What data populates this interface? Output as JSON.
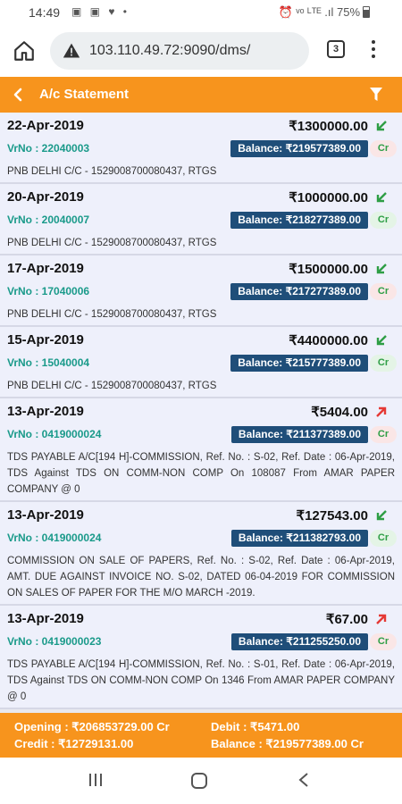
{
  "status": {
    "time": "14:49",
    "icons": "▣ ▣ ♥ •",
    "right": "⏰ ᵛᵒ ᴸᵀᴱ .ıl 75%"
  },
  "browser": {
    "url": "103.110.49.72:9090/dms/",
    "tab_count": "3"
  },
  "header": {
    "title": "A/c Statement"
  },
  "entries": [
    {
      "date": "22-Apr-2019",
      "amount": "₹1300000.00",
      "direction": "in",
      "vrno": "VrNo : 22040003",
      "balance": "Balance: ₹219577389.00",
      "crdr": "Cr",
      "narration": "PNB DELHI C/C - 1529008700080437, RTGS"
    },
    {
      "date": "20-Apr-2019",
      "amount": "₹1000000.00",
      "direction": "in",
      "vrno": "VrNo : 20040007",
      "balance": "Balance: ₹218277389.00",
      "crdr": "Cr",
      "narration": "PNB DELHI C/C - 1529008700080437, RTGS"
    },
    {
      "date": "17-Apr-2019",
      "amount": "₹1500000.00",
      "direction": "in",
      "vrno": "VrNo : 17040006",
      "balance": "Balance: ₹217277389.00",
      "crdr": "Cr",
      "narration": "PNB DELHI C/C - 1529008700080437, RTGS"
    },
    {
      "date": "15-Apr-2019",
      "amount": "₹4400000.00",
      "direction": "in",
      "vrno": "VrNo : 15040004",
      "balance": "Balance: ₹215777389.00",
      "crdr": "Cr",
      "narration": "PNB DELHI C/C - 1529008700080437, RTGS"
    },
    {
      "date": "13-Apr-2019",
      "amount": "₹5404.00",
      "direction": "out",
      "vrno": "VrNo : 0419000024",
      "balance": "Balance: ₹211377389.00",
      "crdr": "Cr",
      "narration": "TDS PAYABLE A/C[194 H]-COMMISSION, Ref. No. : S-02, Ref. Date : 06-Apr-2019, TDS Against TDS ON COMM-NON COMP On 108087 From AMAR PAPER COMPANY @ 0"
    },
    {
      "date": "13-Apr-2019",
      "amount": "₹127543.00",
      "direction": "in",
      "vrno": "VrNo : 0419000024",
      "balance": "Balance: ₹211382793.00",
      "crdr": "Cr",
      "narration": "COMMISSION ON SALE OF PAPERS, Ref. No. : S-02, Ref. Date : 06-Apr-2019, AMT. DUE AGAINST INVOICE NO. S-02, DATED 06-04-2019 FOR COMMISSION ON SALES OF PAPER FOR THE M/O MARCH -2019."
    },
    {
      "date": "13-Apr-2019",
      "amount": "₹67.00",
      "direction": "out",
      "vrno": "VrNo : 0419000023",
      "balance": "Balance: ₹211255250.00",
      "crdr": "Cr",
      "narration": "TDS PAYABLE A/C[194 H]-COMMISSION, Ref. No. : S-01, Ref. Date : 06-Apr-2019, TDS Against TDS ON COMM-NON COMP On 1346 From AMAR PAPER COMPANY @ 0"
    }
  ],
  "footer": {
    "opening": "Opening : ₹206853729.00 Cr",
    "debit": "Debit : ₹5471.00",
    "credit": "Credit : ₹12729131.00",
    "balance": "Balance : ₹219577389.00 Cr"
  },
  "colors": {
    "accent": "#f7941d",
    "balance_bg": "#1f4e79",
    "vrno": "#1a9a8a",
    "in_arrow": "#2e9e45",
    "out_arrow": "#e53935"
  }
}
